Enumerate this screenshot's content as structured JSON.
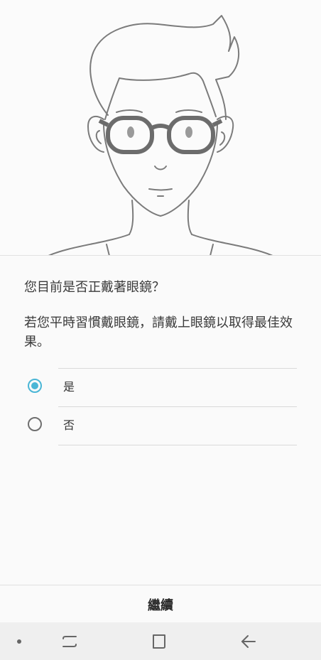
{
  "question": "您目前是否正戴著眼鏡？",
  "hint": "若您平時習慣戴眼鏡，請戴上眼鏡以取得最佳效果。",
  "options": [
    {
      "label": "是",
      "selected": true
    },
    {
      "label": "否",
      "selected": false
    }
  ],
  "continue_label": "繼續",
  "accent_color": "#4ab6d6",
  "nav": {
    "icons": [
      "dot-indicator-icon",
      "recent-apps-icon",
      "home-icon",
      "back-icon"
    ]
  }
}
